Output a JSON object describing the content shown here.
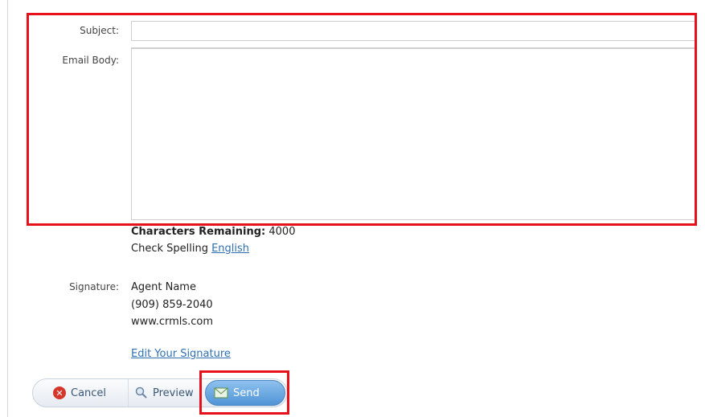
{
  "form": {
    "subject_label": "Subject:",
    "subject_value": "",
    "email_body_label": "Email Body:",
    "email_body_value": "",
    "chars_remaining_label": "Characters Remaining:",
    "chars_remaining_value": "4000",
    "check_spelling_label": "Check Spelling",
    "check_spelling_language": "English",
    "signature_label": "Signature:",
    "signature_lines": [
      "Agent Name",
      "(909) 859-2040",
      "www.crmls.com"
    ],
    "edit_signature_link": "Edit Your Signature"
  },
  "toolbar": {
    "cancel_label": "Cancel",
    "preview_label": "Preview",
    "send_label": "Send"
  },
  "icons": {
    "cancel": "cancel-icon",
    "preview": "preview-icon",
    "send": "send-email-icon"
  },
  "colors": {
    "highlight": "#e8101a",
    "link": "#2f6fb3",
    "send_button": "#4f94d6"
  }
}
